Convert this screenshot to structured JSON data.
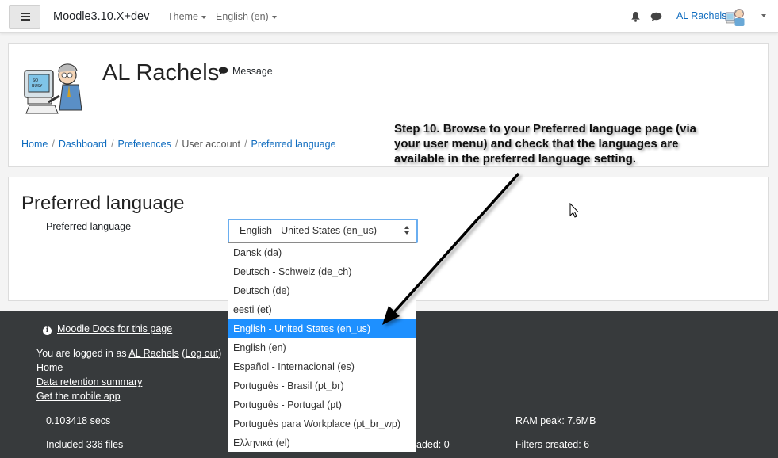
{
  "navbar": {
    "brand": "Moodle3.10.X+dev",
    "menus": [
      "Theme",
      "English (en)"
    ],
    "user_name": "AL Rachels"
  },
  "profile": {
    "name": "AL Rachels",
    "message_label": "Message",
    "breadcrumb": [
      "Home",
      "Dashboard",
      "Preferences",
      "User account",
      "Preferred language"
    ]
  },
  "preferred_language": {
    "title": "Preferred language",
    "label": "Preferred language",
    "selected": "English - United States (en_us)",
    "options": [
      "Dansk (da)",
      "Deutsch - Schweiz (de_ch)",
      "Deutsch (de)",
      "eesti (et)",
      "English - United States (en_us)",
      "English (en)",
      "Español - Internacional (es)",
      "Português - Brasil (pt_br)",
      "Português - Portugal (pt)",
      "Português para Workplace (pt_br_wp)",
      "Ελληνικά (el)"
    ],
    "selected_index": 4
  },
  "annotation": {
    "lines": [
      "Step 10. Browse to your Preferred language page (via",
      "your user menu) and check that the languages are",
      "available in the preferred language setting."
    ]
  },
  "footer": {
    "docs_link": "Moodle Docs for this page",
    "logged_in_prefix": "You are logged in as ",
    "logged_in_user": "AL Rachels",
    "logout": "Log out",
    "links": [
      "Home",
      "Data retention summary",
      "Get the mobile app"
    ],
    "perf": {
      "time": "0.103418 secs",
      "files": "Included 336 files",
      "ram": "RAM peak: 7.6MB",
      "filters": "Filters created: 6",
      "loaded": "aded: 0"
    }
  },
  "colors": {
    "link": "#0f6cbf",
    "select_focus": "#6aaef0",
    "option_highlight": "#1e90ff",
    "footer_bg": "#373a3c"
  }
}
